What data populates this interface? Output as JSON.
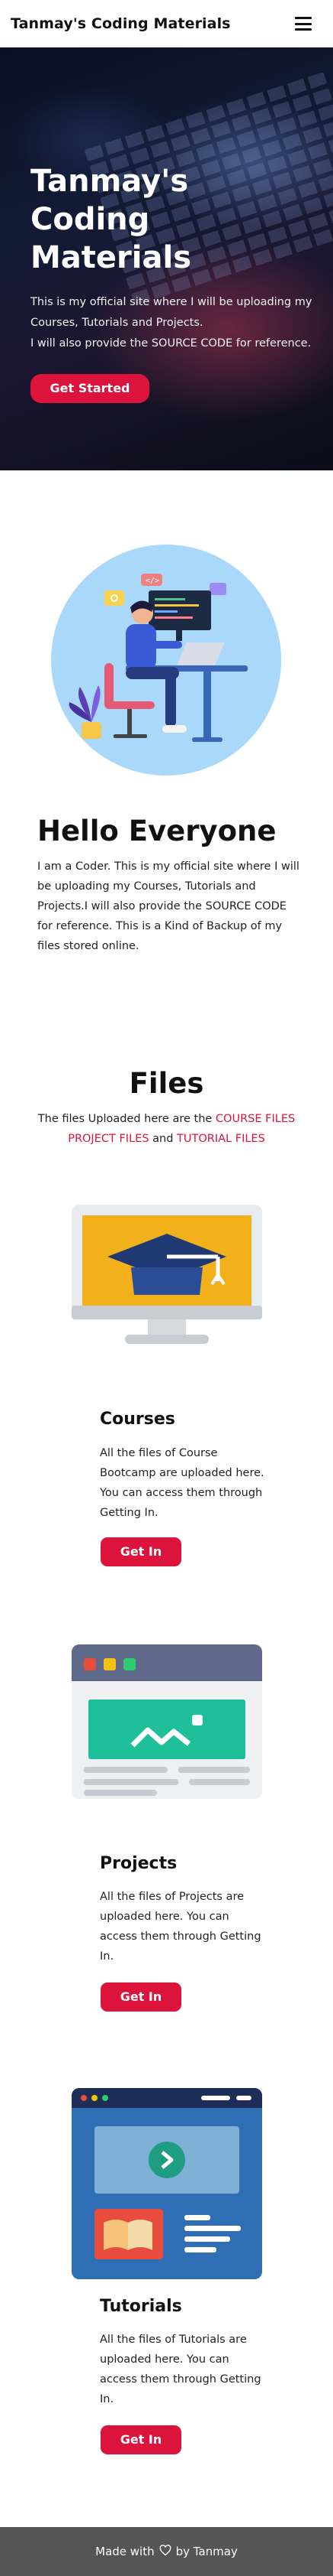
{
  "navbar": {
    "brand": "Tanmay's Coding Materials",
    "menu_icon": "hamburger-icon"
  },
  "hero": {
    "title": "Tanmay's Coding Materials",
    "line1": "This is my official site where I will be uploading my Courses, Tutorials and Projects.",
    "line2": "I will also provide the SOURCE CODE for reference.",
    "cta_label": "Get Started"
  },
  "about": {
    "title": "Hello Everyone",
    "text": "I am a Coder. This is my official site where I will be uploading my Courses, Tutorials and Projects.I will also provide the SOURCE CODE for reference. This is a Kind of Backup of my files stored online."
  },
  "files": {
    "title": "Files",
    "intro": "The files Uploaded here are the",
    "link_courses": "COURSE FILES",
    "link_projects": "PROJECT FILES",
    "and": "and",
    "link_tutorials": "TUTORIAL FILES"
  },
  "cards": [
    {
      "title": "Courses",
      "text": "All the files of Course Bootcamp are uploaded here. You can access them through Getting In.",
      "button": "Get In",
      "icon": "graduation-cap-monitor-icon"
    },
    {
      "title": "Projects",
      "text": "All the files of Projects are uploaded here. You can access them through Getting In.",
      "button": "Get In",
      "icon": "browser-window-icon"
    },
    {
      "title": "Tutorials",
      "text": "All the files of Tutorials are uploaded here. You can access them through Getting In.",
      "button": "Get In",
      "icon": "video-tutorial-icon"
    }
  ],
  "footer": {
    "prefix": "Made with",
    "suffix": "by Tanmay",
    "icon": "heart-outline-icon"
  },
  "colors": {
    "accent": "#dc143c",
    "footer_bg": "#555555",
    "illus_bg": "#aad8fb"
  }
}
